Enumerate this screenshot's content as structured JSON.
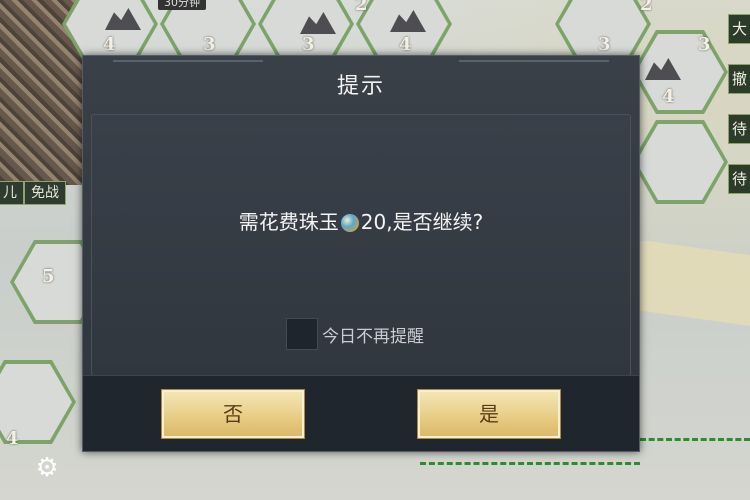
{
  "dialog": {
    "title": "提示",
    "message_before": "需花费珠玉",
    "currency_icon": "pearl-jade-icon",
    "message_after": "20,是否继续?",
    "checkbox_label": "今日不再提醒",
    "checkbox_checked": false,
    "no_button": "否",
    "yes_button": "是"
  },
  "map": {
    "top_timer": "30分钟",
    "left_tags": [
      "儿",
      "免战"
    ],
    "hex_levels": [
      "4",
      "3",
      "3",
      "4",
      "3",
      "3",
      "4",
      "5",
      "4",
      "2",
      "2"
    ],
    "side_tags": [
      "大",
      "撤",
      "待",
      "待"
    ],
    "settings_icon": "gear-icon"
  },
  "colors": {
    "dialog_bg": "#2f353d",
    "button_gold": "#e8cd86",
    "territory_green": "#7da36a"
  }
}
